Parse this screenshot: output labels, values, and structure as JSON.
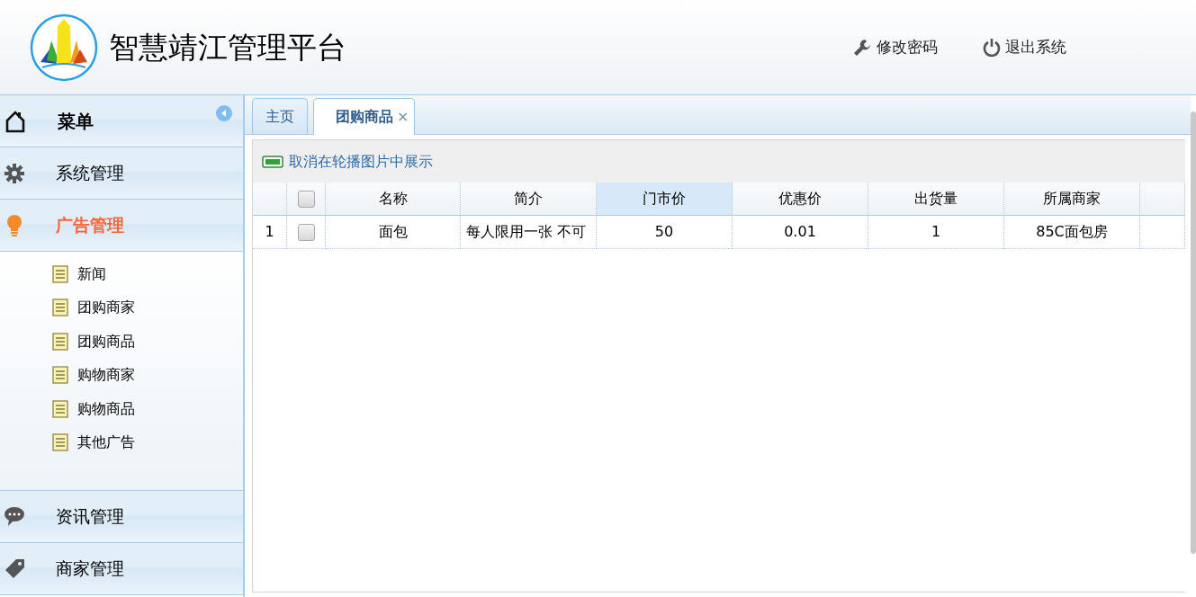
{
  "header": {
    "title": "智慧靖江管理平台",
    "actions": [
      {
        "label": "修改密码"
      },
      {
        "label": "退出系统"
      }
    ]
  },
  "sidebar": {
    "title": "菜单",
    "groups": [
      {
        "label": "系统管理",
        "expanded": false
      },
      {
        "label": "广告管理",
        "expanded": true,
        "children": [
          {
            "label": "新闻"
          },
          {
            "label": "团购商家"
          },
          {
            "label": "团购商品"
          },
          {
            "label": "购物商家"
          },
          {
            "label": "购物商品"
          },
          {
            "label": "其他广告"
          }
        ]
      },
      {
        "label": "资讯管理",
        "expanded": false
      },
      {
        "label": "商家管理",
        "expanded": false
      }
    ]
  },
  "tabs": [
    {
      "label": "主页",
      "selected": false
    },
    {
      "label": "团购商品",
      "selected": true,
      "close": "×"
    }
  ],
  "toolbar": {
    "button": "取消在轮播图片中展示"
  },
  "table": {
    "header_checked": false,
    "columns": [
      {
        "label": "名称",
        "sorted": false
      },
      {
        "label": "简介",
        "sorted": false
      },
      {
        "label": "门市价",
        "sorted": true
      },
      {
        "label": "优惠价",
        "sorted": false
      },
      {
        "label": "出货量",
        "sorted": false
      },
      {
        "label": "所属商家",
        "sorted": false
      }
    ],
    "rows": [
      {
        "number": "1",
        "checked": false,
        "cells": [
          "面包",
          "每人限用一张 不可",
          "50",
          "0.01",
          "1",
          "85C面包房"
        ]
      }
    ]
  }
}
